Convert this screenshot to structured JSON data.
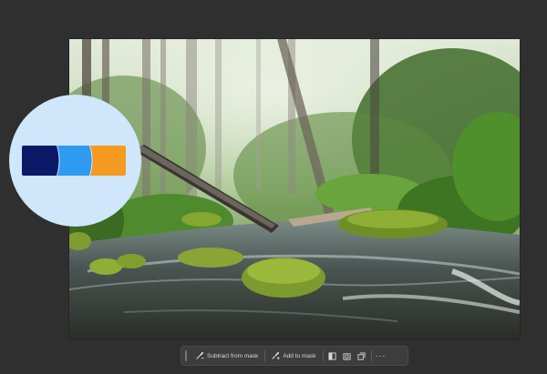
{
  "toolbar": {
    "subtract_label": "Subtract from mask",
    "add_label": "Add to mask",
    "more_label": "···"
  },
  "icons": {
    "subtract": "brush-minus-icon",
    "add": "brush-plus-icon",
    "invert": "invert-mask-icon",
    "refine": "refine-mask-icon",
    "duplicate": "duplicate-mask-icon",
    "more": "more-options-icon"
  },
  "logo_colors": [
    "#0b1a66",
    "#2f9bf0",
    "#f59a21"
  ],
  "colors": {
    "workspace": "#2f2f2f",
    "toolbar": "#3d3d3d",
    "badge": "#cfe6fb"
  }
}
